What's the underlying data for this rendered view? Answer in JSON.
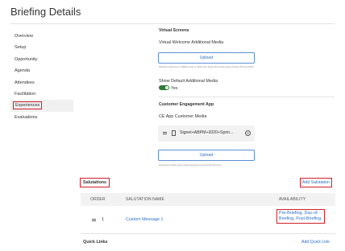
{
  "page": {
    "title": "Briefing Details"
  },
  "sidebar": {
    "items": [
      {
        "label": "Overview"
      },
      {
        "label": "Setup"
      },
      {
        "label": "Opportunity"
      },
      {
        "label": "Agenda"
      },
      {
        "label": "Attendees"
      },
      {
        "label": "Facilitation"
      },
      {
        "label": "Experiences",
        "active": true
      },
      {
        "label": "Evaluations"
      }
    ]
  },
  "virtual_screens": {
    "heading": "Virtual Screens",
    "media_label": "Virtual Welcome Additional Media",
    "upload_label": "Upload",
    "helper_text": "Optimal media size is 1080px wide or 700px tall. Supported media types include JPG and PNG.",
    "toggle_label": "Show Default Additional Media",
    "toggle_value": "Yes"
  },
  "customer_engagement": {
    "heading": "Customer Engagement App",
    "media_label": "CE App Customer Media",
    "file_name": "Signet+ABPM+2020+Sprin...",
    "upload_label": "Upload",
    "helper_text": "Supported media types include jpg,jpeg,png,mp4,pdf,mov,wmv"
  },
  "salutations": {
    "heading": "Salutations",
    "add_label": "Add Salutation",
    "columns": [
      "ORDER",
      "SALUTATION NAME",
      "AVAILABILITY"
    ],
    "rows": [
      {
        "order": "1",
        "name": "Custom Message 1",
        "availability": "Pre-Briefing, Day-of-Briefing, Post-Briefing"
      }
    ]
  },
  "quick_links": {
    "heading": "Quick Links",
    "add_label": "Add Quick Link"
  },
  "colors": {
    "accent_blue": "#2f6fc4",
    "highlight_red": "#d11f2a",
    "toggle_green": "#2e7d32"
  }
}
